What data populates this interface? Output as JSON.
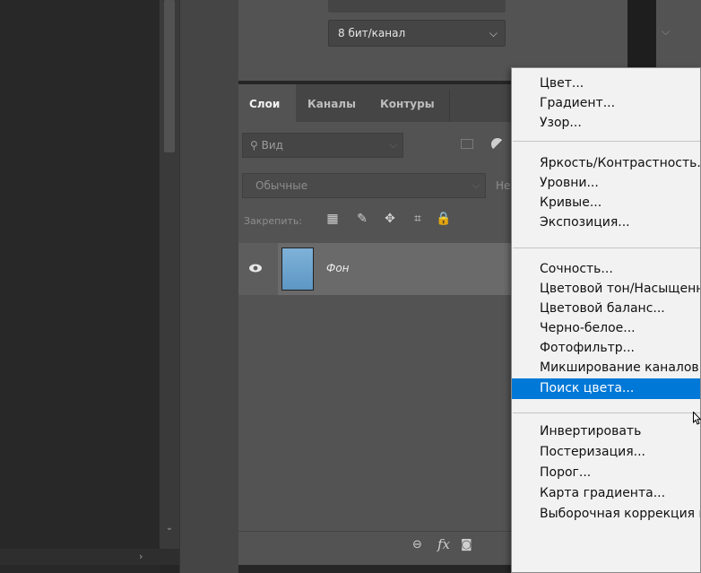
{
  "toolbar": {
    "bit_depth_value": "8 бит/канал"
  },
  "layers_panel": {
    "tabs": [
      "Слои",
      "Каналы",
      "Контуры"
    ],
    "search_placeholder": "Вид",
    "blend_mode": "Обычные",
    "opacity_label_partial": "Не",
    "lock_label": "Закрепить:",
    "layer": {
      "name": "Фон",
      "visible": true
    }
  },
  "menu": {
    "groups": [
      [
        "Цвет...",
        "Градиент...",
        "Узор..."
      ],
      [
        "Яркость/Контрастность...",
        "Уровни...",
        "Кривые...",
        "Экспозиция..."
      ],
      [
        "Сочность...",
        "Цветовой тон/Насыщенность...",
        "Цветовой баланс...",
        "Черно-белое...",
        "Фотофильтр...",
        "Микширование каналов...",
        "Поиск цвета..."
      ],
      [
        "Инвертировать",
        "Постеризация...",
        "Порог...",
        "Карта градиента...",
        "Выборочная коррекция цвета..."
      ]
    ],
    "selected": "Поиск цвета..."
  },
  "colors": {
    "menu_highlight": "#0078d7",
    "panel_bg": "#535353",
    "workspace_bg": "#282828"
  }
}
